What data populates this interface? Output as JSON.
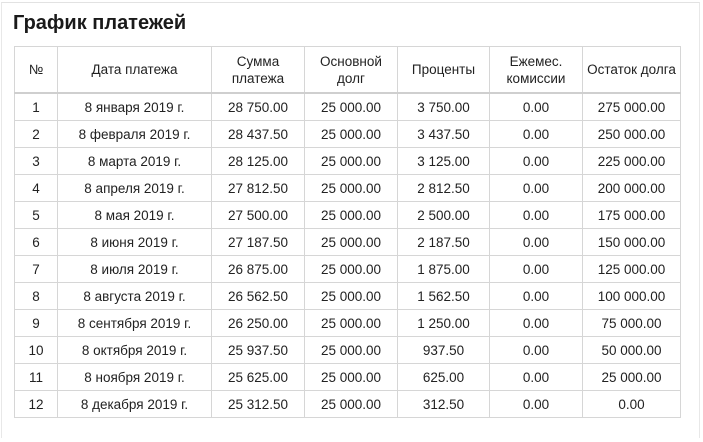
{
  "page": {
    "title": "График платежей"
  },
  "table": {
    "columns": [
      {
        "key": "num",
        "label": "№"
      },
      {
        "key": "date",
        "label": "Дата платежа"
      },
      {
        "key": "amount",
        "label": "Сумма платежа"
      },
      {
        "key": "principal",
        "label": "Основной долг"
      },
      {
        "key": "interest",
        "label": "Проценты"
      },
      {
        "key": "commission",
        "label": "Ежемес. комиссии"
      },
      {
        "key": "balance",
        "label": "Остаток долга"
      }
    ],
    "rows": [
      {
        "num": "1",
        "date": "8 января 2019 г.",
        "amount": "28 750.00",
        "principal": "25 000.00",
        "interest": "3 750.00",
        "commission": "0.00",
        "balance": "275 000.00"
      },
      {
        "num": "2",
        "date": "8 февраля 2019 г.",
        "amount": "28 437.50",
        "principal": "25 000.00",
        "interest": "3 437.50",
        "commission": "0.00",
        "balance": "250 000.00"
      },
      {
        "num": "3",
        "date": "8 марта 2019 г.",
        "amount": "28 125.00",
        "principal": "25 000.00",
        "interest": "3 125.00",
        "commission": "0.00",
        "balance": "225 000.00"
      },
      {
        "num": "4",
        "date": "8 апреля 2019 г.",
        "amount": "27 812.50",
        "principal": "25 000.00",
        "interest": "2 812.50",
        "commission": "0.00",
        "balance": "200 000.00"
      },
      {
        "num": "5",
        "date": "8 мая 2019 г.",
        "amount": "27 500.00",
        "principal": "25 000.00",
        "interest": "2 500.00",
        "commission": "0.00",
        "balance": "175 000.00"
      },
      {
        "num": "6",
        "date": "8 июня 2019 г.",
        "amount": "27 187.50",
        "principal": "25 000.00",
        "interest": "2 187.50",
        "commission": "0.00",
        "balance": "150 000.00"
      },
      {
        "num": "7",
        "date": "8 июля 2019 г.",
        "amount": "26 875.00",
        "principal": "25 000.00",
        "interest": "1 875.00",
        "commission": "0.00",
        "balance": "125 000.00"
      },
      {
        "num": "8",
        "date": "8 августа 2019 г.",
        "amount": "26 562.50",
        "principal": "25 000.00",
        "interest": "1 562.50",
        "commission": "0.00",
        "balance": "100 000.00"
      },
      {
        "num": "9",
        "date": "8 сентября 2019 г.",
        "amount": "26 250.00",
        "principal": "25 000.00",
        "interest": "1 250.00",
        "commission": "0.00",
        "balance": "75 000.00"
      },
      {
        "num": "10",
        "date": "8 октября 2019 г.",
        "amount": "25 937.50",
        "principal": "25 000.00",
        "interest": "937.50",
        "commission": "0.00",
        "balance": "50 000.00"
      },
      {
        "num": "11",
        "date": "8 ноября 2019 г.",
        "amount": "25 625.00",
        "principal": "25 000.00",
        "interest": "625.00",
        "commission": "0.00",
        "balance": "25 000.00"
      },
      {
        "num": "12",
        "date": "8 декабря 2019 г.",
        "amount": "25 312.50",
        "principal": "25 000.00",
        "interest": "312.50",
        "commission": "0.00",
        "balance": "0.00"
      }
    ]
  }
}
